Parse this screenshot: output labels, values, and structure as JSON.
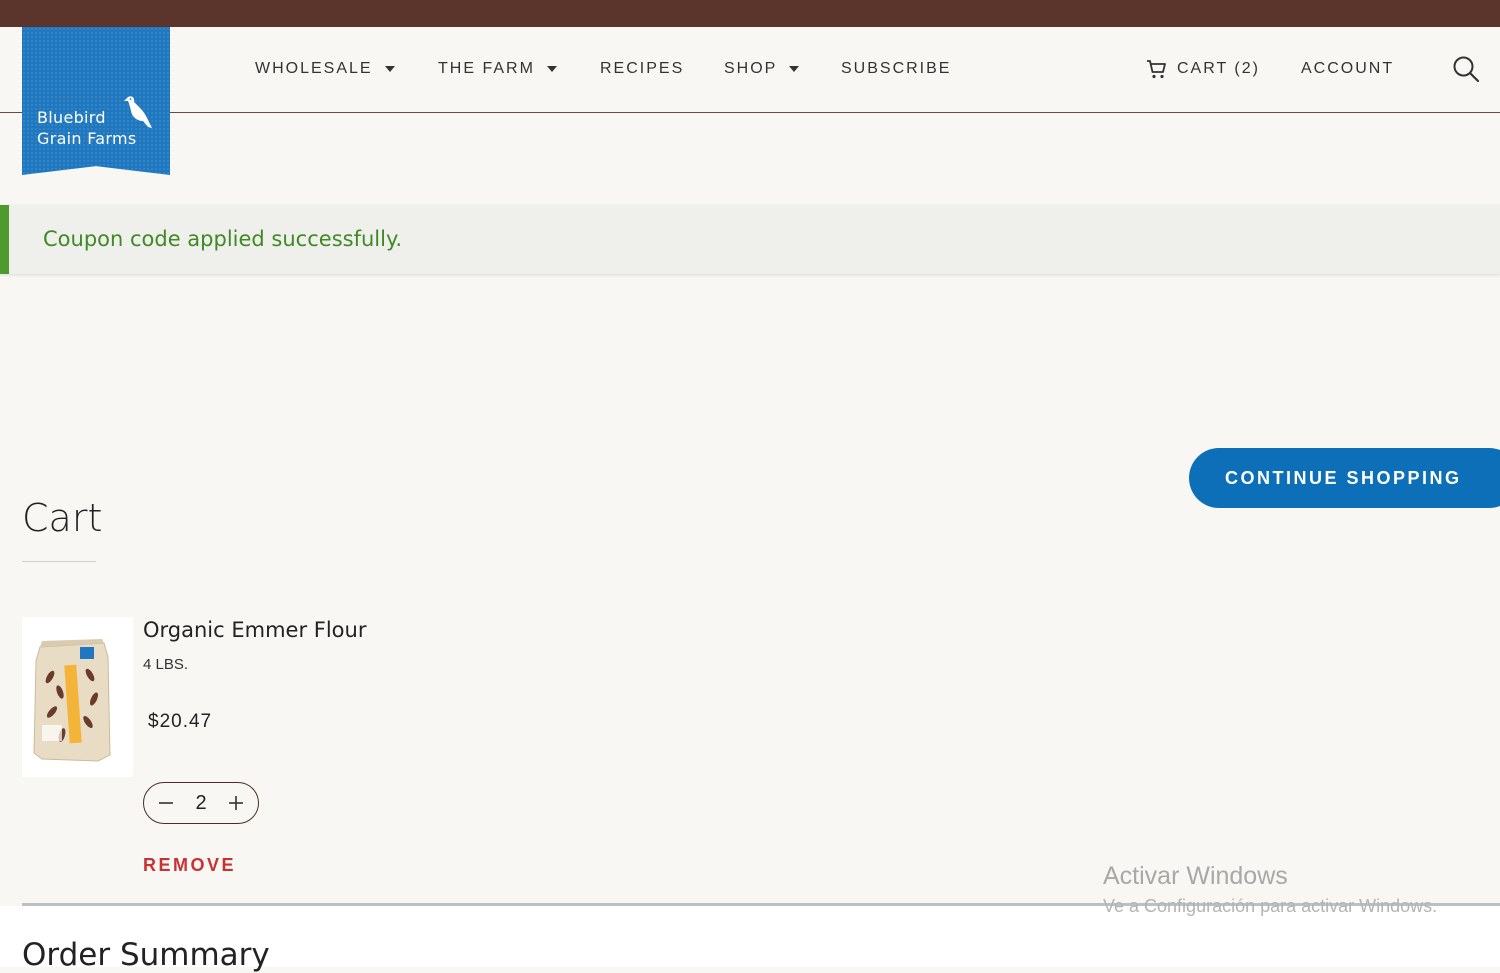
{
  "brand": {
    "name_line1": "Bluebird",
    "name_line2": "Grain Farms",
    "color": "#1f78bf"
  },
  "nav": {
    "items": [
      {
        "label": "WHOLESALE",
        "dropdown": true
      },
      {
        "label": "THE FARM",
        "dropdown": true
      },
      {
        "label": "RECIPES",
        "dropdown": false
      },
      {
        "label": "SHOP",
        "dropdown": true
      },
      {
        "label": "SUBSCRIBE",
        "dropdown": false
      }
    ],
    "cart_label": "CART (2)",
    "account_label": "ACCOUNT",
    "icons": {
      "cart": "cart-icon",
      "search": "search-icon"
    }
  },
  "alert": {
    "message": "Coupon code applied successfully.",
    "color": "#3f8a26"
  },
  "actions": {
    "continue_shopping": "CONTINUE SHOPPING",
    "accent": "#0d6fb8"
  },
  "cart": {
    "title": "Cart",
    "items": [
      {
        "name": "Organic Emmer Flour",
        "variant": "4 LBS.",
        "price": "$20.47",
        "quantity": "2",
        "remove_label": "REMOVE"
      }
    ]
  },
  "order_summary": {
    "title": "Order Summary"
  },
  "watermark": {
    "line1": "Activar Windows",
    "line2": "Ve a Configuración para activar Windows."
  }
}
